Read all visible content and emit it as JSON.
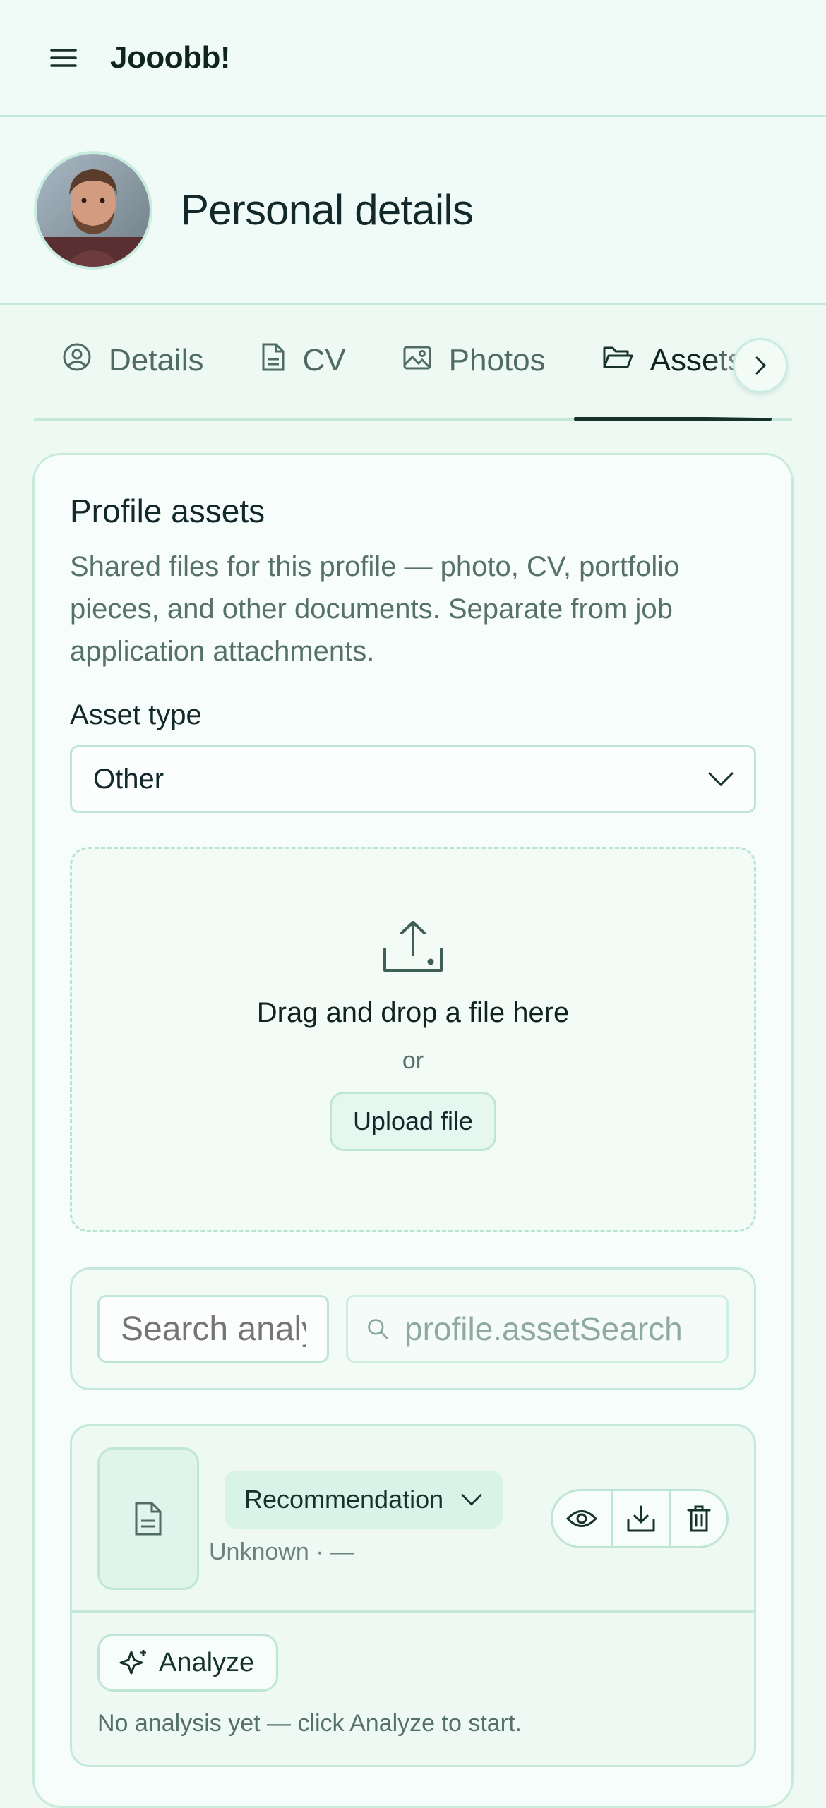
{
  "header": {
    "title": "Jooobb!",
    "menu_icon": "hamburger-menu-icon"
  },
  "profile": {
    "title": "Personal details"
  },
  "tabs": [
    {
      "label": "Details",
      "icon": "user-circle-icon",
      "active": false
    },
    {
      "label": "CV",
      "icon": "document-icon",
      "active": false
    },
    {
      "label": "Photos",
      "icon": "image-icon",
      "active": false
    },
    {
      "label": "Assets",
      "icon": "folder-open-icon",
      "active": true
    }
  ],
  "assets": {
    "title": "Profile assets",
    "description": "Shared files for this profile — photo, CV, portfolio pieces, and other documents. Separate from job application attachments.",
    "type_label": "Asset type",
    "type_value": "Other",
    "dropzone": {
      "title": "Drag and drop a file here",
      "or": "or",
      "upload_label": "Upload file"
    },
    "search": {
      "analysis_placeholder": "Search analysis",
      "asset_placeholder": "profile.assetSearch"
    },
    "item": {
      "type": "Recommendation",
      "meta": "Unknown · —",
      "analyze_label": "Analyze",
      "analysis_note": "No analysis yet — click Analyze to start."
    }
  },
  "colors": {
    "accent": "#17322b",
    "background": "#eef9f4",
    "border": "#c4e9db",
    "chip": "#d8f3e7"
  }
}
